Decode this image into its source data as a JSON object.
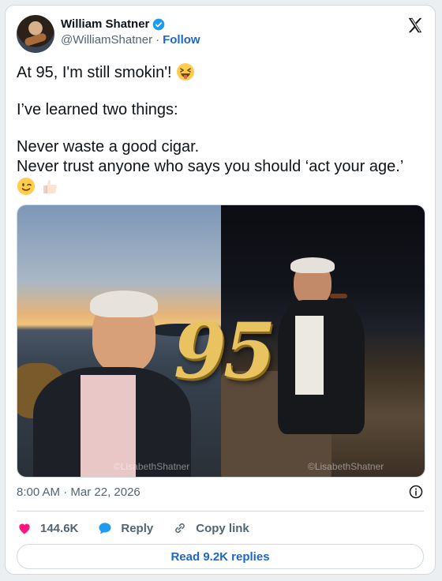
{
  "author": {
    "name": "William Shatner",
    "handle": "@WilliamShatner",
    "separator": "·",
    "follow_label": "Follow"
  },
  "tweet": {
    "line1": "At 95, I'm still smokin'!",
    "line2": "I’ve learned two things:",
    "line3": "Never waste a good cigar.",
    "line4": "Never trust anyone who says you should ‘act your age.’",
    "emojis": [
      "squinting-face-with-tongue",
      "winking-face",
      "thumbs-up"
    ]
  },
  "media": {
    "overlay_text": "95",
    "credit_left": "©LisabethShatner",
    "credit_right": "©LisabethShatner"
  },
  "meta": {
    "time": "8:00 AM",
    "date": "Mar 22, 2026"
  },
  "actions": {
    "like_count": "144.6K",
    "reply_label": "Reply",
    "copy_label": "Copy link"
  },
  "read_replies_label": "Read 9.2K replies",
  "colors": {
    "link": "#1d67c9",
    "verified": "#1d9bf0",
    "like": "#f91880",
    "border": "#cfd9de",
    "muted": "#536471"
  }
}
